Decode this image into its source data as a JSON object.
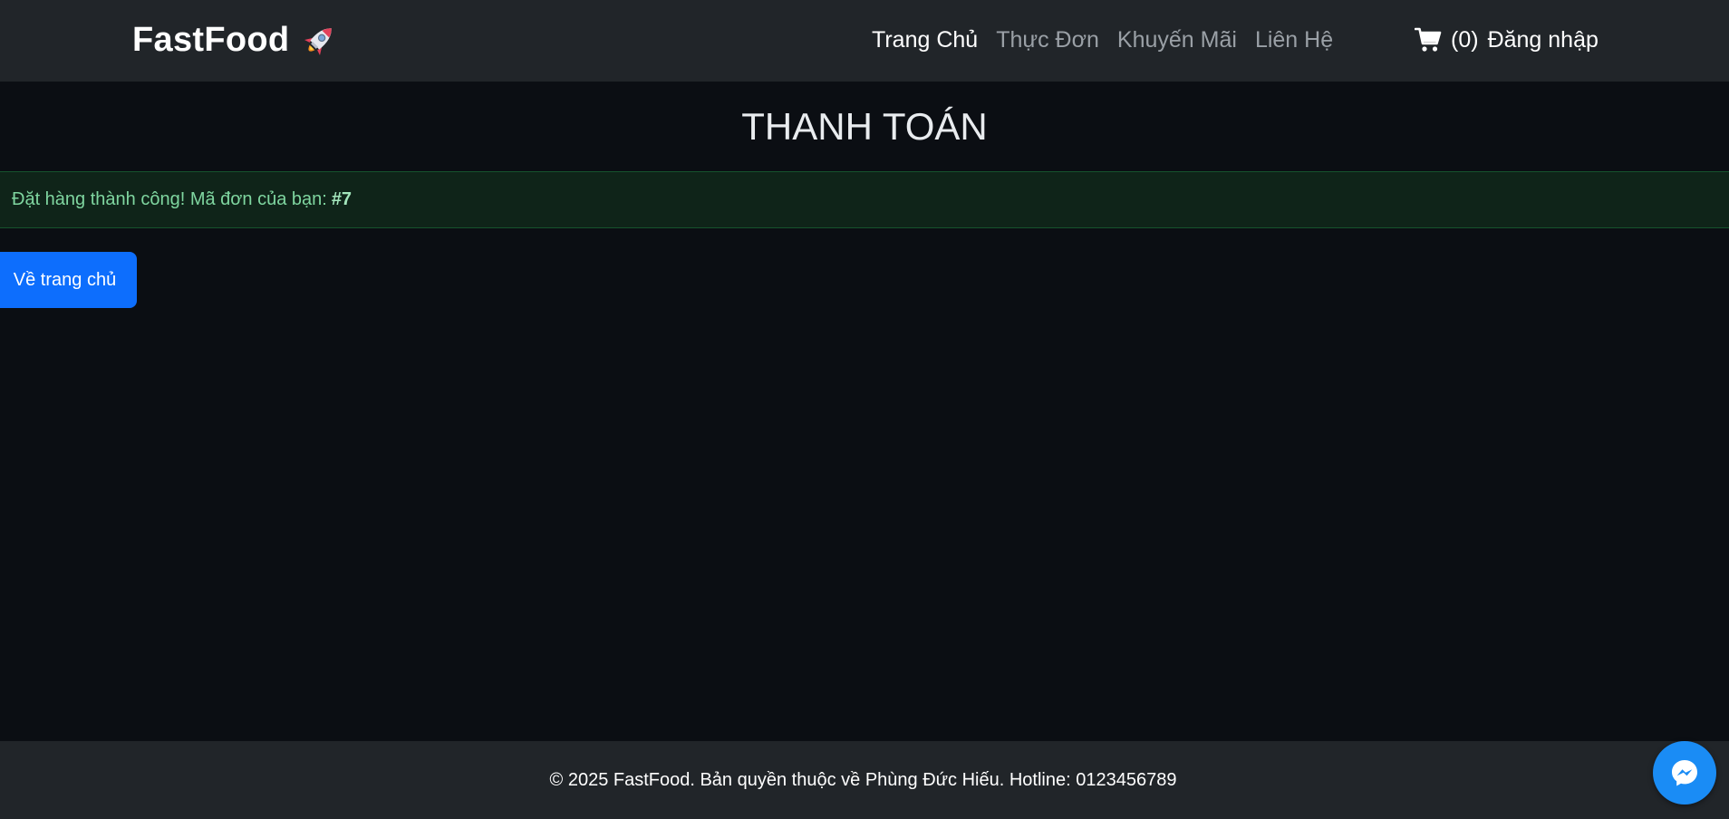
{
  "navbar": {
    "brand": "FastFood",
    "brand_icon": "rocket-icon",
    "links": [
      {
        "label": "Trang Chủ",
        "active": true
      },
      {
        "label": "Thực Đơn",
        "active": false
      },
      {
        "label": "Khuyến Mãi",
        "active": false
      },
      {
        "label": "Liên Hệ",
        "active": false
      }
    ],
    "cart_icon": "cart-icon",
    "cart_count": "(0)",
    "login_label": "Đăng nhập"
  },
  "main": {
    "title": "THANH TOÁN",
    "alert": {
      "message": "Đặt hàng thành công! Mã đơn của bạn:",
      "order_id": "#7"
    },
    "home_button_label": "Về trang chủ"
  },
  "footer": {
    "text": "© 2025 FastFood. Bản quyền thuộc về Phùng Đức Hiếu. Hotline: 0123456789"
  },
  "floating": {
    "messenger_icon": "messenger-icon"
  },
  "colors": {
    "page_background": "#0b0e13",
    "navbar_background": "#212529",
    "alert_background": "#0f2419",
    "alert_text": "#7fd6a0",
    "primary_button": "#0d6efd",
    "messenger": "#1a8cf5"
  }
}
